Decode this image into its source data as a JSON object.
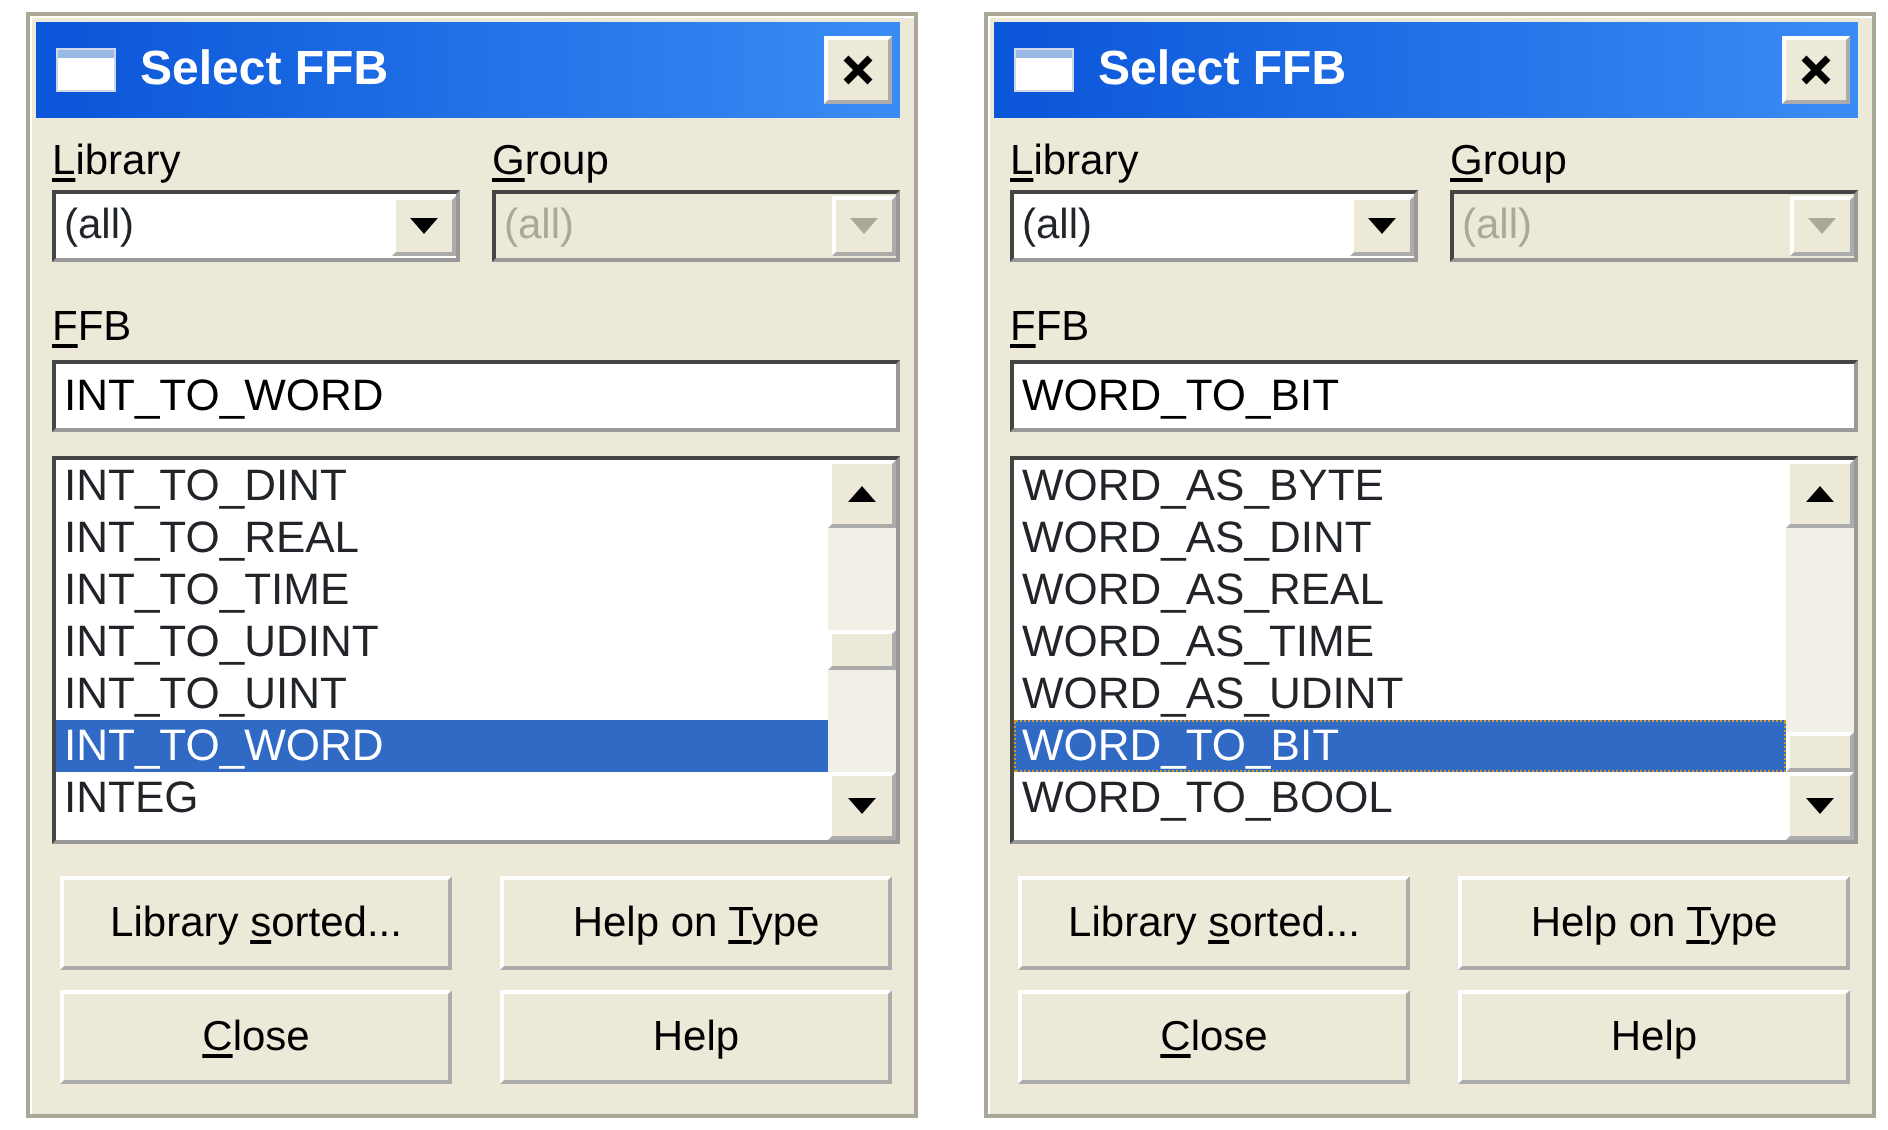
{
  "dialogs": [
    {
      "title": "Select FFB",
      "library": {
        "label": {
          "key": "L",
          "post": "ibrary"
        },
        "value": "(all)",
        "disabled": false
      },
      "group": {
        "label": {
          "key": "G",
          "post": "roup"
        },
        "value": "(all)",
        "disabled": true
      },
      "ffb": {
        "label": {
          "key": "F",
          "post": "FB"
        },
        "value": "INT_TO_WORD"
      },
      "items": [
        {
          "text": "INT_TO_DINT",
          "selected": false,
          "focused": false
        },
        {
          "text": "INT_TO_REAL",
          "selected": false,
          "focused": false
        },
        {
          "text": "INT_TO_TIME",
          "selected": false,
          "focused": false
        },
        {
          "text": "INT_TO_UDINT",
          "selected": false,
          "focused": false
        },
        {
          "text": "INT_TO_UINT",
          "selected": false,
          "focused": false
        },
        {
          "text": "INT_TO_WORD",
          "selected": true,
          "focused": false
        },
        {
          "text": "INTEG",
          "selected": false,
          "focused": false
        }
      ],
      "buttons": [
        {
          "pre": "Library ",
          "key": "s",
          "post": "orted..."
        },
        {
          "pre": "Help on ",
          "key": "T",
          "post": "ype"
        },
        {
          "key": "C",
          "post": "lose"
        },
        {
          "pre": "Help"
        }
      ]
    },
    {
      "title": "Select FFB",
      "library": {
        "label": {
          "key": "L",
          "post": "ibrary"
        },
        "value": "(all)",
        "disabled": false
      },
      "group": {
        "label": {
          "key": "G",
          "post": "roup"
        },
        "value": "(all)",
        "disabled": true
      },
      "ffb": {
        "label": {
          "key": "F",
          "post": "FB"
        },
        "value": "WORD_TO_BIT"
      },
      "items": [
        {
          "text": "WORD_AS_BYTE",
          "selected": false,
          "focused": false
        },
        {
          "text": "WORD_AS_DINT",
          "selected": false,
          "focused": false
        },
        {
          "text": "WORD_AS_REAL",
          "selected": false,
          "focused": false
        },
        {
          "text": "WORD_AS_TIME",
          "selected": false,
          "focused": false
        },
        {
          "text": "WORD_AS_UDINT",
          "selected": false,
          "focused": false
        },
        {
          "text": "WORD_TO_BIT",
          "selected": true,
          "focused": true
        },
        {
          "text": "WORD_TO_BOOL",
          "selected": false,
          "focused": false
        }
      ],
      "buttons": [
        {
          "pre": "Library ",
          "key": "s",
          "post": "orted..."
        },
        {
          "pre": "Help on ",
          "key": "T",
          "post": "ype"
        },
        {
          "key": "C",
          "post": "lose"
        },
        {
          "pre": "Help"
        }
      ]
    }
  ]
}
